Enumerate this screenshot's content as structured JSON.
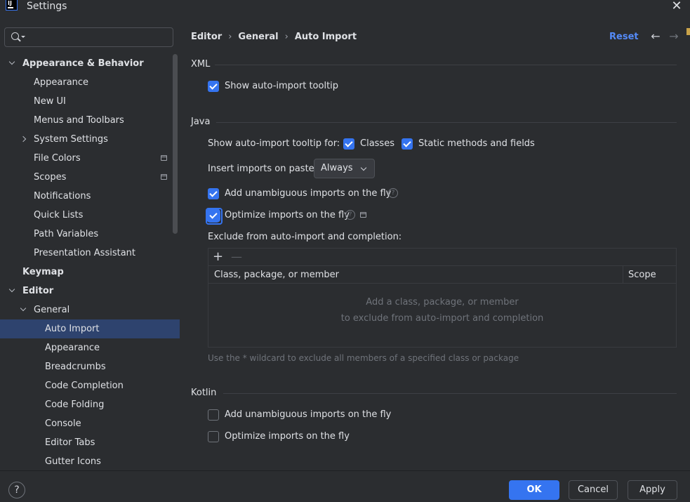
{
  "window": {
    "title": "Settings",
    "close_icon": "close-icon"
  },
  "search": {
    "placeholder": "",
    "value": ""
  },
  "sidebar": {
    "items": [
      {
        "label": "Appearance & Behavior",
        "level": 0,
        "bold": true,
        "expander": "down"
      },
      {
        "label": "Appearance",
        "level": 1
      },
      {
        "label": "New UI",
        "level": 1
      },
      {
        "label": "Menus and Toolbars",
        "level": 1
      },
      {
        "label": "System Settings",
        "level": 1,
        "expander": "right"
      },
      {
        "label": "File Colors",
        "level": 1,
        "project_icon": true
      },
      {
        "label": "Scopes",
        "level": 1,
        "project_icon": true
      },
      {
        "label": "Notifications",
        "level": 1
      },
      {
        "label": "Quick Lists",
        "level": 1
      },
      {
        "label": "Path Variables",
        "level": 1
      },
      {
        "label": "Presentation Assistant",
        "level": 1
      },
      {
        "label": "Keymap",
        "level": 0,
        "bold": true
      },
      {
        "label": "Editor",
        "level": 0,
        "bold": true,
        "expander": "down"
      },
      {
        "label": "General",
        "level": 1,
        "expander": "down"
      },
      {
        "label": "Auto Import",
        "level": 2,
        "selected": true
      },
      {
        "label": "Appearance",
        "level": 2
      },
      {
        "label": "Breadcrumbs",
        "level": 2
      },
      {
        "label": "Code Completion",
        "level": 2
      },
      {
        "label": "Code Folding",
        "level": 2
      },
      {
        "label": "Console",
        "level": 2
      },
      {
        "label": "Editor Tabs",
        "level": 2
      },
      {
        "label": "Gutter Icons",
        "level": 2
      }
    ]
  },
  "header": {
    "breadcrumb": [
      "Editor",
      "General",
      "Auto Import"
    ],
    "separator": "›",
    "reset_label": "Reset",
    "back_icon": "arrow-left-icon",
    "forward_icon": "arrow-right-icon"
  },
  "xml": {
    "title": "XML",
    "show_tooltip": {
      "label": "Show auto-import tooltip",
      "checked": true
    }
  },
  "java": {
    "title": "Java",
    "tooltip_for_label": "Show auto-import tooltip for:",
    "classes": {
      "label": "Classes",
      "checked": true
    },
    "static_methods": {
      "label": "Static methods and fields",
      "checked": true
    },
    "insert_on_paste_label": "Insert imports on paste:",
    "insert_on_paste_value": "Always",
    "add_unambiguous": {
      "label": "Add unambiguous imports on the fly",
      "checked": true
    },
    "optimize_imports": {
      "label": "Optimize imports on the fly",
      "checked": true
    },
    "exclude_label": "Exclude from auto-import and completion:",
    "table": {
      "add_label": "+",
      "remove_label": "—",
      "columns": [
        "Class, package, or member",
        "Scope"
      ],
      "empty_line1": "Add a class, package, or member",
      "empty_line2": "to exclude from auto-import and completion"
    },
    "hint": "Use the * wildcard to exclude all members of a specified class or package"
  },
  "kotlin": {
    "title": "Kotlin",
    "add_unambiguous": {
      "label": "Add unambiguous imports on the fly",
      "checked": false
    },
    "optimize_imports": {
      "label": "Optimize imports on the fly",
      "checked": false
    }
  },
  "footer": {
    "help_label": "?",
    "ok_label": "OK",
    "cancel_label": "Cancel",
    "apply_label": "Apply"
  },
  "colors": {
    "background": "#2b2d30",
    "accent": "#3574f0",
    "link": "#548af7",
    "selection": "#2e436e"
  }
}
